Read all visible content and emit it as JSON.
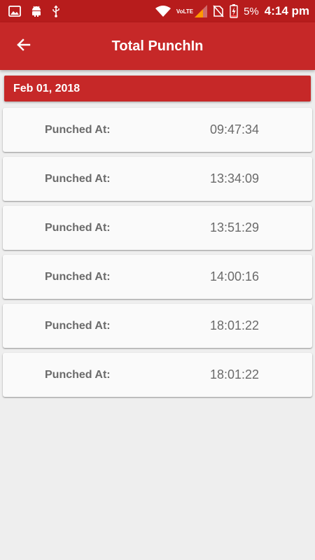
{
  "status_bar": {
    "time": "4:14 pm",
    "battery_percent": "5%",
    "network_label": "VoLTE",
    "icons": [
      "gallery-icon",
      "android-icon",
      "usb-icon",
      "wifi-icon",
      "signal-icon",
      "no-sim-icon",
      "battery-charging-icon"
    ]
  },
  "app_bar": {
    "title": "Total PunchIn",
    "back_icon": "arrow-left-icon"
  },
  "date_header": "Feb 01, 2018",
  "punches": [
    {
      "label": "Punched At:",
      "time": "09:47:34"
    },
    {
      "label": "Punched At:",
      "time": "13:34:09"
    },
    {
      "label": "Punched At:",
      "time": "13:51:29"
    },
    {
      "label": "Punched At:",
      "time": "14:00:16"
    },
    {
      "label": "Punched At:",
      "time": "18:01:22"
    },
    {
      "label": "Punched At:",
      "time": "18:01:22"
    }
  ],
  "colors": {
    "status_bar": "#b71c1c",
    "primary": "#c62828",
    "background": "#eeeeee",
    "card": "#fafafa",
    "text_secondary": "#6b6b6b"
  }
}
